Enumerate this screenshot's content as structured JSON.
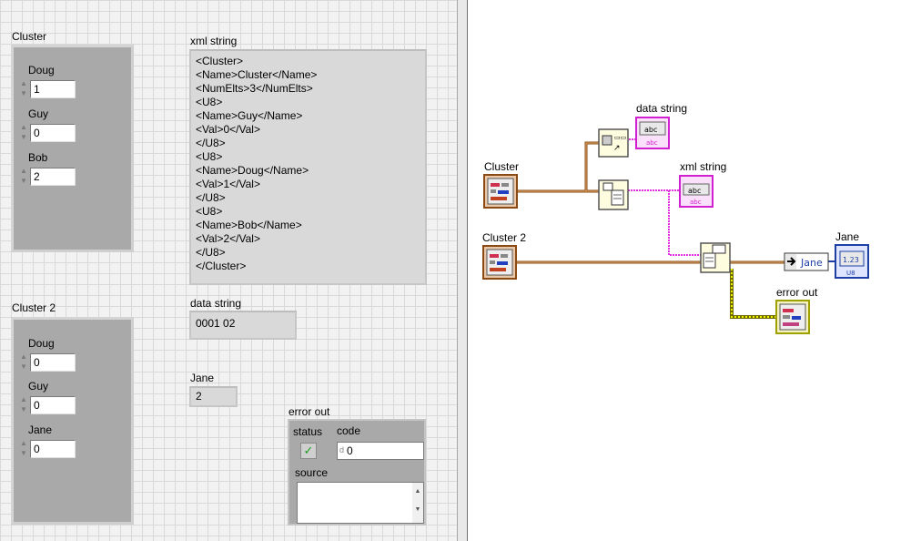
{
  "front_panel": {
    "cluster1": {
      "label": "Cluster",
      "items": [
        {
          "label": "Doug",
          "value": "1"
        },
        {
          "label": "Guy",
          "value": "0"
        },
        {
          "label": "Bob",
          "value": "2"
        }
      ]
    },
    "cluster2": {
      "label": "Cluster 2",
      "items": [
        {
          "label": "Doug",
          "value": "0"
        },
        {
          "label": "Guy",
          "value": "0"
        },
        {
          "label": "Jane",
          "value": "0"
        }
      ]
    },
    "xml_string": {
      "label": "xml string",
      "lines": [
        "<Cluster>",
        "<Name>Cluster</Name>",
        "<NumElts>3</NumElts>",
        "<U8>",
        "<Name>Guy</Name>",
        "<Val>0</Val>",
        "</U8>",
        "<U8>",
        "<Name>Doug</Name>",
        "<Val>1</Val>",
        "</U8>",
        "<U8>",
        "<Name>Bob</Name>",
        "<Val>2</Val>",
        "</U8>",
        "</Cluster>"
      ]
    },
    "data_string": {
      "label": "data string",
      "value": "0001 02"
    },
    "jane": {
      "label": "Jane",
      "value": "2"
    },
    "error_out": {
      "label": "error out",
      "status_label": "status",
      "code_label": "code",
      "code_value": "0",
      "code_radix": "d",
      "source_label": "source",
      "source_value": ""
    }
  },
  "block_diagram": {
    "data_string_label": "data string",
    "xml_string_label": "xml string",
    "cluster_label": "Cluster",
    "cluster2_label": "Cluster 2",
    "jane_label": "Jane",
    "error_out_label": "error out",
    "unbundle_element": "Jane",
    "string_glyph": "abc",
    "numeric_glyph": "1.23",
    "numeric_type": "U8"
  },
  "colors": {
    "cluster_wire": "#8b4a14",
    "string_wire": "#e030e0",
    "numeric_wire": "#1e3fa6",
    "error_wire": "#c8c800"
  }
}
